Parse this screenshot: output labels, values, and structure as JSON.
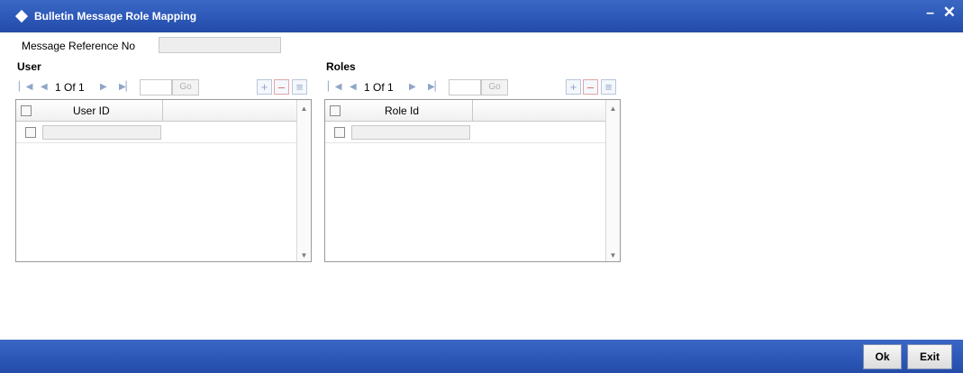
{
  "window": {
    "title": "Bulletin Message Role Mapping",
    "minimize_glyph": "–",
    "close_glyph": "✕",
    "titlebar_color": "#2d58b8"
  },
  "message_ref": {
    "label": "Message Reference No",
    "value": ""
  },
  "user_section": {
    "title": "User",
    "pager": {
      "page_text": "1 Of 1",
      "go_label": "Go"
    },
    "grid": {
      "column_header": "User ID",
      "rows": [
        {
          "value": ""
        }
      ]
    }
  },
  "roles_section": {
    "title": "Roles",
    "pager": {
      "page_text": "1 Of 1",
      "go_label": "Go"
    },
    "grid": {
      "column_header": "Role Id",
      "rows": [
        {
          "value": ""
        }
      ]
    }
  },
  "icons": {
    "first": "▏◀",
    "prev": "◀",
    "next": "▶",
    "last": "▶▏",
    "add": "+",
    "remove": "–",
    "view": "≡",
    "scroll_up": "▲",
    "scroll_down": "▼"
  },
  "footer": {
    "ok_label": "Ok",
    "exit_label": "Exit"
  }
}
